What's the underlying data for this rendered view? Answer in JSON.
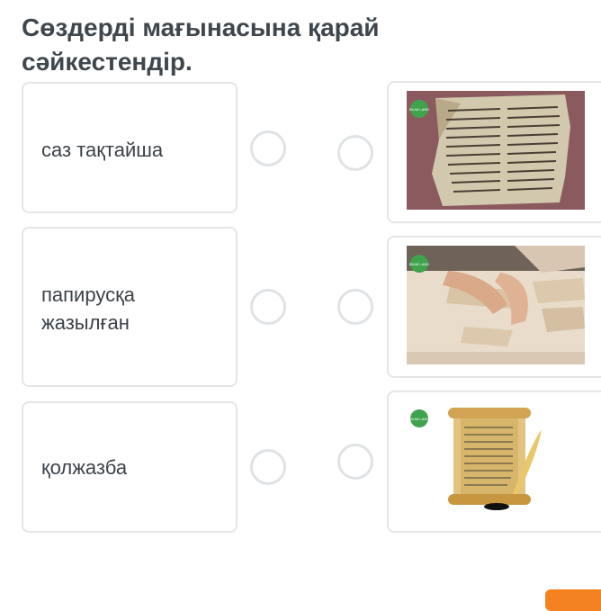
{
  "question": {
    "title": "Сөздерді мағынасына қарай сәйкестендір."
  },
  "words": [
    {
      "text": "саз тақтайша"
    },
    {
      "text": "папирусқа жазылған"
    },
    {
      "text": "қолжазба"
    }
  ],
  "images": [
    {
      "alt": "ancient manuscript page",
      "badge_text": "BILIM LAND"
    },
    {
      "alt": "hands shaping clay tablets",
      "badge_text": "BILIM LAND"
    },
    {
      "alt": "papyrus scroll with quill",
      "badge_text": "BILIM LAND"
    }
  ],
  "colors": {
    "accent": "#f58220",
    "badge": "#3fa34d"
  }
}
